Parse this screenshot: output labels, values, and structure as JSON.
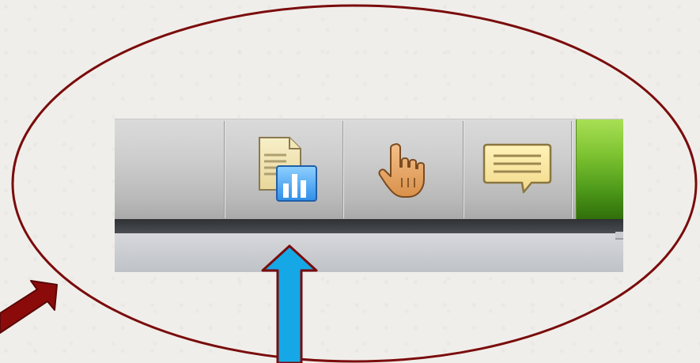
{
  "toolbar": {
    "buttons": [
      {
        "name": "blank",
        "icon": "none"
      },
      {
        "name": "report",
        "icon": "document-chart-icon"
      },
      {
        "name": "hand",
        "icon": "hand-pointer-icon"
      },
      {
        "name": "comment",
        "icon": "speech-bubble-icon"
      }
    ],
    "accent_panel_color": "#5fae23"
  },
  "annotations": {
    "ellipse_color": "#7a0c0c",
    "left_arrow_color": "#8b0b0b",
    "up_arrow_color": "#16a8e6"
  }
}
